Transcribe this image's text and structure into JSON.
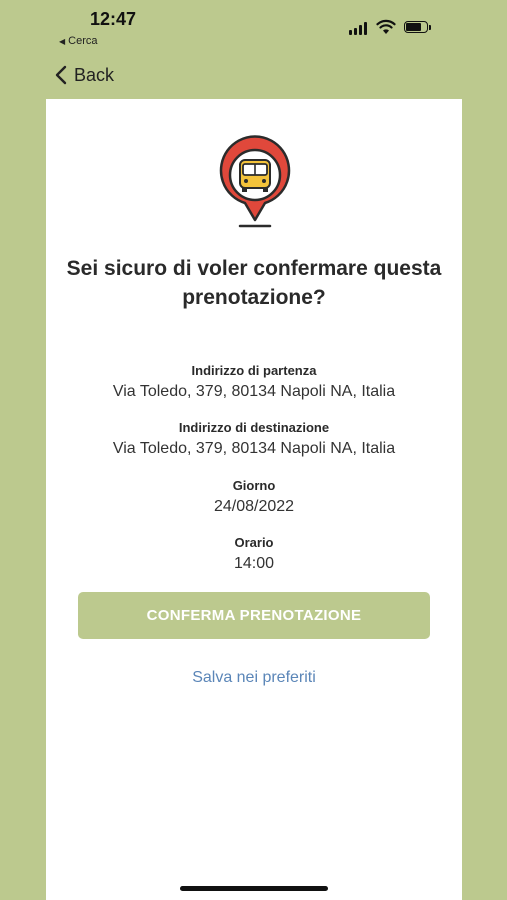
{
  "status_bar": {
    "time": "12:47",
    "back_app_label": "Cerca"
  },
  "nav": {
    "back_label": "Back"
  },
  "dialog": {
    "icon": "bus-location-pin-icon",
    "question": "Sei sicuro di voler confermare questa prenotazione?",
    "fields": [
      {
        "label": "Indirizzo di partenza",
        "value": "Via Toledo, 379, 80134 Napoli NA, Italia"
      },
      {
        "label": "Indirizzo di destinazione",
        "value": "Via Toledo, 379, 80134 Napoli NA, Italia"
      },
      {
        "label": "Giorno",
        "value": "24/08/2022"
      },
      {
        "label": "Orario",
        "value": "14:00"
      }
    ],
    "confirm_label": "CONFERMA PRENOTAZIONE",
    "save_label": "Salva nei preferiti"
  },
  "colors": {
    "accent": "#bcc98e",
    "link": "#5b86b8",
    "pin_red": "#e0483b",
    "bus_yellow": "#f4c33a"
  }
}
